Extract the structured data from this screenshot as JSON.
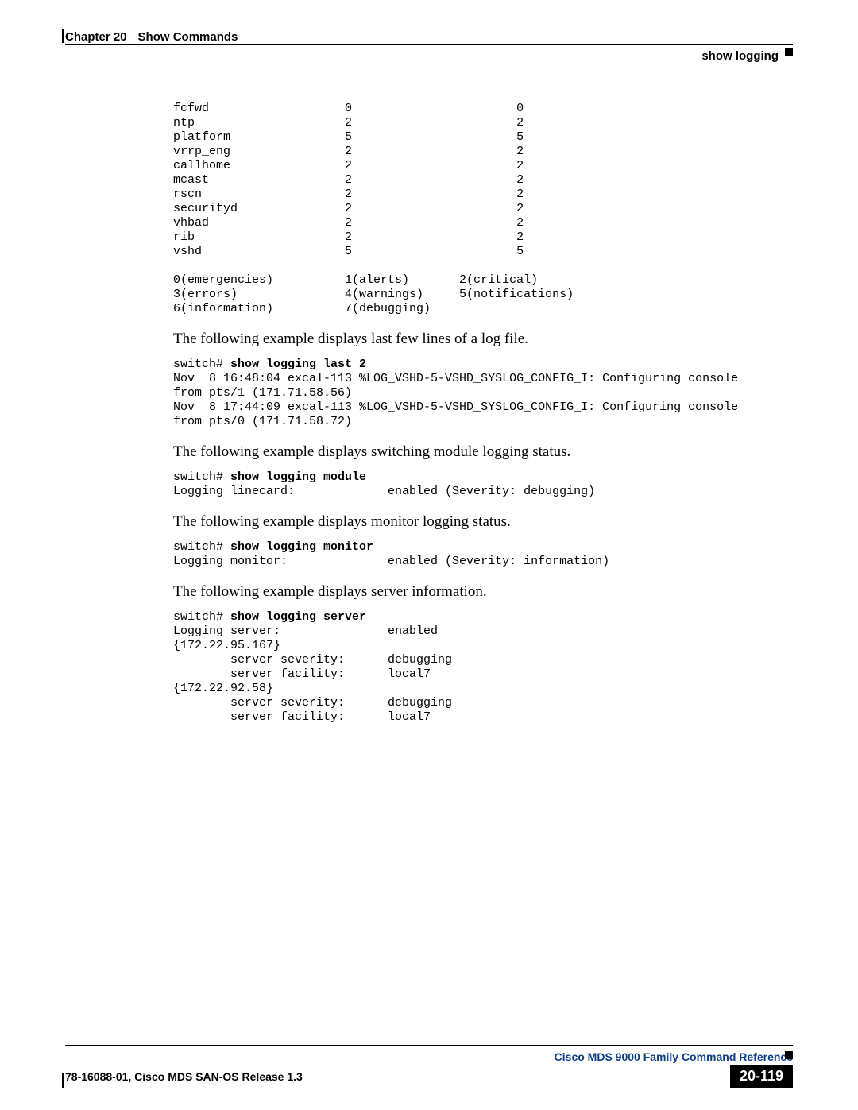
{
  "header": {
    "chapter": "Chapter 20",
    "title": "Show Commands",
    "subtitle": "show logging"
  },
  "block1": "fcfwd                   0                       0\nntp                     2                       2\nplatform                5                       5\nvrrp_eng                2                       2\ncallhome                2                       2\nmcast                   2                       2\nrscn                    2                       2\nsecurityd               2                       2\nvhbad                   2                       2\nrib                     2                       2\nvshd                    5                       5\n\n0(emergencies)          1(alerts)       2(critical)\n3(errors)               4(warnings)     5(notifications)\n6(information)          7(debugging)",
  "para1": "The following example displays last few lines of a log file.",
  "cmd2_prefix": "switch# ",
  "cmd2_bold": "show logging last 2",
  "block2_rest": "Nov  8 16:48:04 excal-113 %LOG_VSHD-5-VSHD_SYSLOG_CONFIG_I: Configuring console\nfrom pts/1 (171.71.58.56)\nNov  8 17:44:09 excal-113 %LOG_VSHD-5-VSHD_SYSLOG_CONFIG_I: Configuring console\nfrom pts/0 (171.71.58.72)",
  "para2": "The following example displays switching module logging status.",
  "cmd3_prefix": "switch# ",
  "cmd3_bold": "show logging module",
  "block3_rest": "Logging linecard:             enabled (Severity: debugging)",
  "para3": "The following example displays monitor logging status.",
  "cmd4_prefix": "switch# ",
  "cmd4_bold": "show logging monitor",
  "block4_rest": "Logging monitor:              enabled (Severity: information)",
  "para4": "The following example displays server information.",
  "cmd5_prefix": "switch# ",
  "cmd5_bold": "show logging server",
  "block5_rest": "Logging server:               enabled\n{172.22.95.167}\n        server severity:      debugging\n        server facility:      local7\n{172.22.92.58}\n        server severity:      debugging\n        server facility:      local7",
  "footer": {
    "product": "Cisco MDS 9000 Family Command Reference",
    "release": "78-16088-01, Cisco MDS SAN-OS Release 1.3",
    "page": "20-119"
  }
}
